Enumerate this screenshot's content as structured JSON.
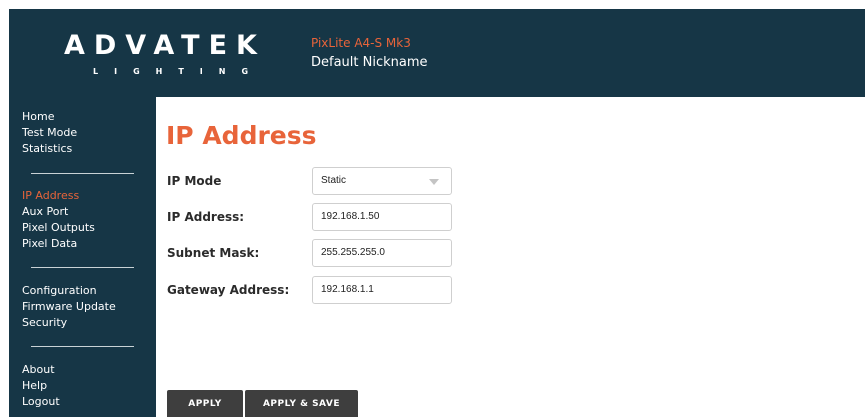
{
  "brand": {
    "logo_text": "ADVATEK",
    "logo_subtext": "LIGHTING"
  },
  "device": {
    "model": "PixLite A4-S Mk3",
    "nickname": "Default Nickname"
  },
  "sidebar": {
    "groups": [
      [
        "Home",
        "Test Mode",
        "Statistics"
      ],
      [
        "IP Address",
        "Aux Port",
        "Pixel Outputs",
        "Pixel Data"
      ],
      [
        "Configuration",
        "Firmware Update",
        "Security"
      ],
      [
        "About",
        "Help",
        "Logout"
      ]
    ],
    "active": "IP Address"
  },
  "page": {
    "title": "IP Address"
  },
  "form": {
    "ip_mode": {
      "label": "IP Mode",
      "value": "Static"
    },
    "ip_address": {
      "label": "IP Address:",
      "value": "192.168.1.50"
    },
    "subnet_mask": {
      "label": "Subnet Mask:",
      "value": "255.255.255.0"
    },
    "gateway_address": {
      "label": "Gateway Address:",
      "value": "192.168.1.1"
    }
  },
  "buttons": {
    "apply": "APPLY",
    "apply_save": "APPLY & SAVE"
  },
  "colors": {
    "sidebar_bg": "#163646",
    "accent": "#e8643a",
    "button_bg": "#3e3e3e"
  }
}
